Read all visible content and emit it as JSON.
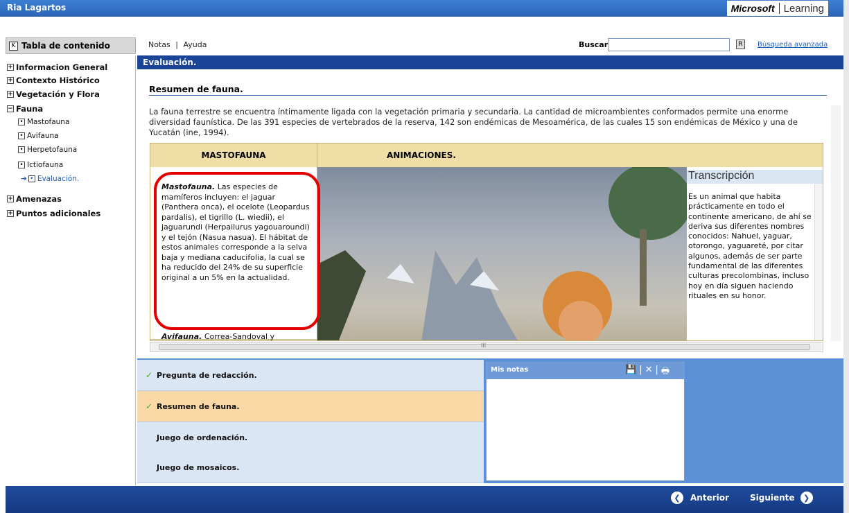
{
  "header": {
    "user": "Ria Lagartos",
    "brand": "Microsoft",
    "brand_product": "Learning"
  },
  "toolbar": {
    "toc_label": "Tabla de contenido",
    "toc_key": "K",
    "notas": "Notas",
    "ayuda": "Ayuda",
    "buscar_label": "Buscar",
    "search_value": "",
    "search_go": "R",
    "advanced_search": "Búsqueda avanzada"
  },
  "toc": [
    {
      "label": "Informacion General",
      "symbol": "+"
    },
    {
      "label": "Contexto Histórico",
      "symbol": "+"
    },
    {
      "label": "Vegetación y Flora",
      "symbol": "+"
    },
    {
      "label": "Fauna",
      "symbol": "−"
    },
    {
      "label": "Mastofauna",
      "symbol": "•"
    },
    {
      "label": "Avifauna",
      "symbol": "•"
    },
    {
      "label": "Herpetofauna",
      "symbol": "•"
    },
    {
      "label": "Ictiofauna",
      "symbol": "•"
    },
    {
      "label": "Evaluación.",
      "symbol": "•"
    },
    {
      "label": "Amenazas",
      "symbol": "+"
    },
    {
      "label": "Puntos adicionales",
      "symbol": "+"
    }
  ],
  "main": {
    "section_header": "Evaluación.",
    "title": "Resumen de fauna.",
    "intro": "La fauna terrestre se encuentra íntimamente ligada con la vegetación primaria y secundaria. La cantidad de microambientes conformados permite una enorme diversidad faunística. De las 391 especies de vertebrados de la reserva, 142 son endémicas de Mesoamérica, de las cuales 15 son endémicas de México y una de Yucatán (ine, 1994).",
    "table": {
      "col1_header": "MASTOFAUNA",
      "col2_header": "ANIMACIONES.",
      "masto_term": "Mastofauna.",
      "masto_text": "Las especies de mamíferos incluyen: el jaguar (Panthera onca), el ocelote (Leopardus pardalis), el tigrillo (L. wiedii), el jaguarundi (Herpailurus yagouaroundi) y el tejón (Nasua nasua). El hábitat de estos animales corresponde a la selva baja y mediana caducifolia, la cual se ha reducido del 24% de su superficie original a un 5% en la actualidad.",
      "avi_term": "Avifauna.",
      "avi_text": "Correa-Sandoval y",
      "transcript_title": "Transcripción",
      "transcript_text": "Es un animal que habita prácticamente en todo el continente americano, de ahí se deriva sus diferentes nombres conocidos: Nahuel, yaguar, otorongo, yaguareté, por citar algunos, además de ser parte fundamental de las diferentes culturas precolombinas, incluso hoy en día siguen haciendo rituales en su honor.",
      "hscroll_grip": "III"
    }
  },
  "activities": [
    {
      "label": "Pregunta de redacción.",
      "done": true,
      "check": "✓"
    },
    {
      "label": "Resumen de fauna.",
      "done": true,
      "check": "✓"
    },
    {
      "label": "Juego de ordenación.",
      "done": false,
      "check": ""
    },
    {
      "label": "Juego de mosaicos.",
      "done": false,
      "check": ""
    }
  ],
  "notes": {
    "label": "Mis notas",
    "value": ""
  },
  "footer": {
    "prev": "Anterior",
    "next": "Siguiente"
  },
  "colors": {
    "header_blue": "#1a4596",
    "table_header": "#efdfa6",
    "active_row": "#fbd9a6",
    "highlight_red": "#e30000"
  }
}
